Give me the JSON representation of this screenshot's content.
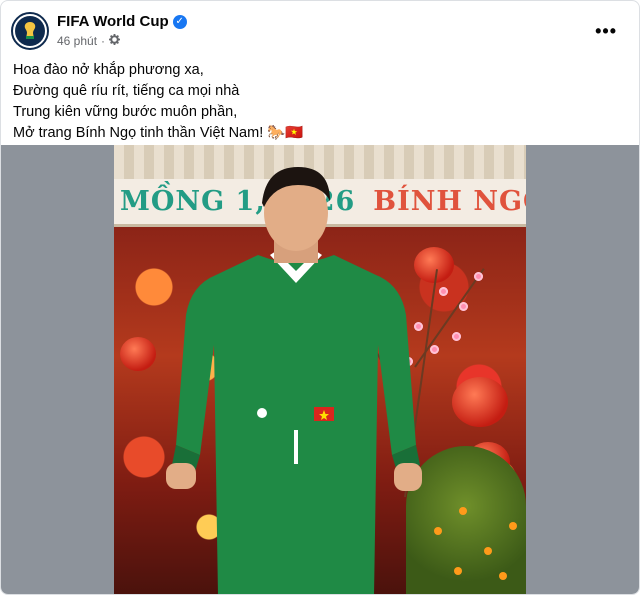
{
  "post": {
    "page_name": "FIFA World Cup",
    "time": "46 phút",
    "caption_lines": [
      "Hoa đào nở khắp phương xa,",
      "Đường quê ríu rít, tiếng ca mọi nhà",
      "Trung kiên vững bước muôn phần,",
      "Mở trang Bính Ngọ tinh thần Việt Nam! 🐎🇻🇳"
    ],
    "more_label": "•••"
  },
  "image": {
    "sign_date": "MỒNG 1, 2026",
    "sign_year": "BÍNH NGỌ",
    "jersey_number": "1"
  },
  "icons": {
    "verified": "verified-badge-icon",
    "privacy": "gear-icon",
    "more": "ellipsis-icon"
  },
  "colors": {
    "accent": "#1877f2",
    "jersey": "#1f8a45",
    "sign_green": "#239c85",
    "sign_red": "#e0533d"
  }
}
